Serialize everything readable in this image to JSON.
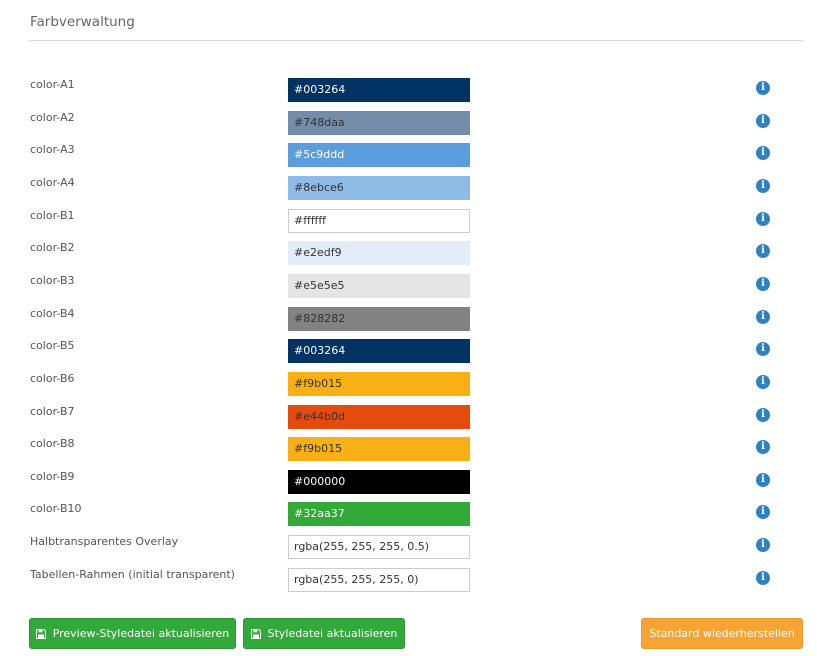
{
  "page": {
    "title": "Farbverwaltung"
  },
  "colors": [
    {
      "label": "color-A1",
      "value": "#003264",
      "bg": "#003264",
      "fg": "#ffffff"
    },
    {
      "label": "color-A2",
      "value": "#748daa",
      "bg": "#748daa",
      "fg": "#333333"
    },
    {
      "label": "color-A3",
      "value": "#5c9ddd",
      "bg": "#5c9ddd",
      "fg": "#ffffff"
    },
    {
      "label": "color-A4",
      "value": "#8ebce6",
      "bg": "#8ebce6",
      "fg": "#333333"
    },
    {
      "label": "color-B1",
      "value": "#ffffff",
      "bg": "#ffffff",
      "fg": "#333333"
    },
    {
      "label": "color-B2",
      "value": "#e2edf9",
      "bg": "#e2edf9",
      "fg": "#333333"
    },
    {
      "label": "color-B3",
      "value": "#e5e5e5",
      "bg": "#e5e5e5",
      "fg": "#333333"
    },
    {
      "label": "color-B4",
      "value": "#828282",
      "bg": "#828282",
      "fg": "#333333"
    },
    {
      "label": "color-B5",
      "value": "#003264",
      "bg": "#003264",
      "fg": "#ffffff"
    },
    {
      "label": "color-B6",
      "value": "#f9b015",
      "bg": "#f9b015",
      "fg": "#333333"
    },
    {
      "label": "color-B7",
      "value": "#e44b0d",
      "bg": "#e44b0d",
      "fg": "#333333"
    },
    {
      "label": "color-B8",
      "value": "#f9b015",
      "bg": "#f9b015",
      "fg": "#333333"
    },
    {
      "label": "color-B9",
      "value": "#000000",
      "bg": "#000000",
      "fg": "#ffffff"
    },
    {
      "label": "color-B10",
      "value": "#32aa37",
      "bg": "#32aa37",
      "fg": "#ffffff"
    },
    {
      "label": "Halbtransparentes Overlay",
      "value": "rgba(255, 255, 255, 0.5)",
      "bg": "#ffffff",
      "fg": "#333333"
    },
    {
      "label": "Tabellen-Rahmen (initial transparent)",
      "value": "rgba(255, 255, 255, 0)",
      "bg": "#ffffff",
      "fg": "#333333"
    }
  ],
  "info_icon": "info-icon",
  "buttons": {
    "preview_label": "Preview-Styledatei aktualisieren",
    "update_label": "Styledatei aktualisieren",
    "reset_label": "Standard wiederherstellen",
    "save_icon": "save-icon"
  },
  "theme": {
    "primary_button": "#34a93b",
    "secondary_button": "#f8a335",
    "info": "#2e82c4"
  }
}
